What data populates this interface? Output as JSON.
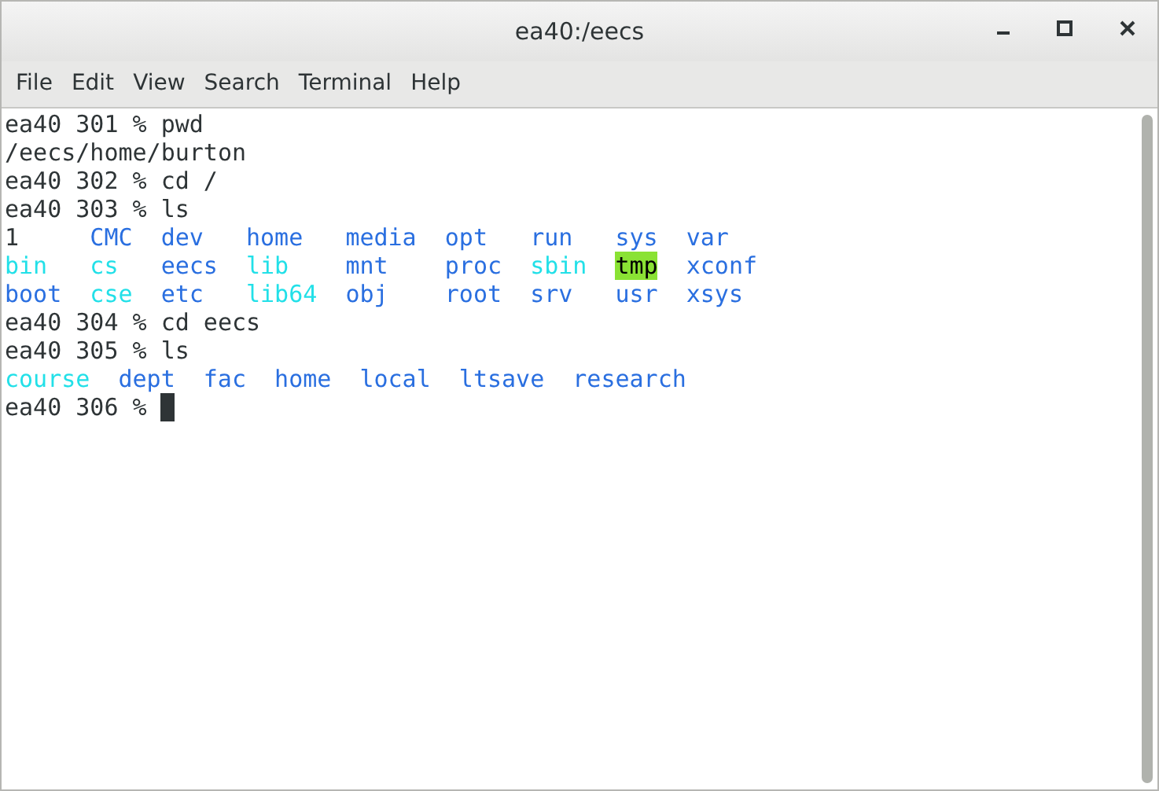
{
  "window": {
    "title": "ea40:/eecs"
  },
  "menu": [
    "File",
    "Edit",
    "View",
    "Search",
    "Terminal",
    "Help"
  ],
  "terminal": {
    "lines": [
      {
        "kind": "text",
        "text": "ea40 301 % pwd"
      },
      {
        "kind": "text",
        "text": "/eecs/home/burton"
      },
      {
        "kind": "text",
        "text": "ea40 302 % cd /"
      },
      {
        "kind": "text",
        "text": "ea40 303 % ls"
      },
      {
        "kind": "listing",
        "rows": [
          [
            {
              "name": "1",
              "kind": "file"
            },
            {
              "name": "CMC",
              "kind": "dir"
            },
            {
              "name": "dev",
              "kind": "dir"
            },
            {
              "name": "home",
              "kind": "dir"
            },
            {
              "name": "media",
              "kind": "dir"
            },
            {
              "name": "opt",
              "kind": "dir"
            },
            {
              "name": "run",
              "kind": "dir"
            },
            {
              "name": "sys",
              "kind": "dir"
            },
            {
              "name": "var",
              "kind": "dir"
            }
          ],
          [
            {
              "name": "bin",
              "kind": "link"
            },
            {
              "name": "cs",
              "kind": "link"
            },
            {
              "name": "eecs",
              "kind": "dir"
            },
            {
              "name": "lib",
              "kind": "link"
            },
            {
              "name": "mnt",
              "kind": "dir"
            },
            {
              "name": "proc",
              "kind": "dir"
            },
            {
              "name": "sbin",
              "kind": "link"
            },
            {
              "name": "tmp",
              "kind": "sticky"
            },
            {
              "name": "xconf",
              "kind": "dir"
            }
          ],
          [
            {
              "name": "boot",
              "kind": "dir"
            },
            {
              "name": "cse",
              "kind": "link"
            },
            {
              "name": "etc",
              "kind": "dir"
            },
            {
              "name": "lib64",
              "kind": "link"
            },
            {
              "name": "obj",
              "kind": "dir"
            },
            {
              "name": "root",
              "kind": "dir"
            },
            {
              "name": "srv",
              "kind": "dir"
            },
            {
              "name": "usr",
              "kind": "dir"
            },
            {
              "name": "xsys",
              "kind": "dir"
            }
          ]
        ]
      },
      {
        "kind": "text",
        "text": "ea40 304 % cd eecs"
      },
      {
        "kind": "text",
        "text": "ea40 305 % ls"
      },
      {
        "kind": "listing",
        "rows": [
          [
            {
              "name": "course",
              "kind": "link"
            },
            {
              "name": "dept",
              "kind": "dir"
            },
            {
              "name": "fac",
              "kind": "dir"
            },
            {
              "name": "home",
              "kind": "dir"
            },
            {
              "name": "local",
              "kind": "dir"
            },
            {
              "name": "ltsave",
              "kind": "dir"
            },
            {
              "name": "research",
              "kind": "dir"
            }
          ]
        ]
      },
      {
        "kind": "prompt",
        "text": "ea40 306 % "
      }
    ]
  }
}
